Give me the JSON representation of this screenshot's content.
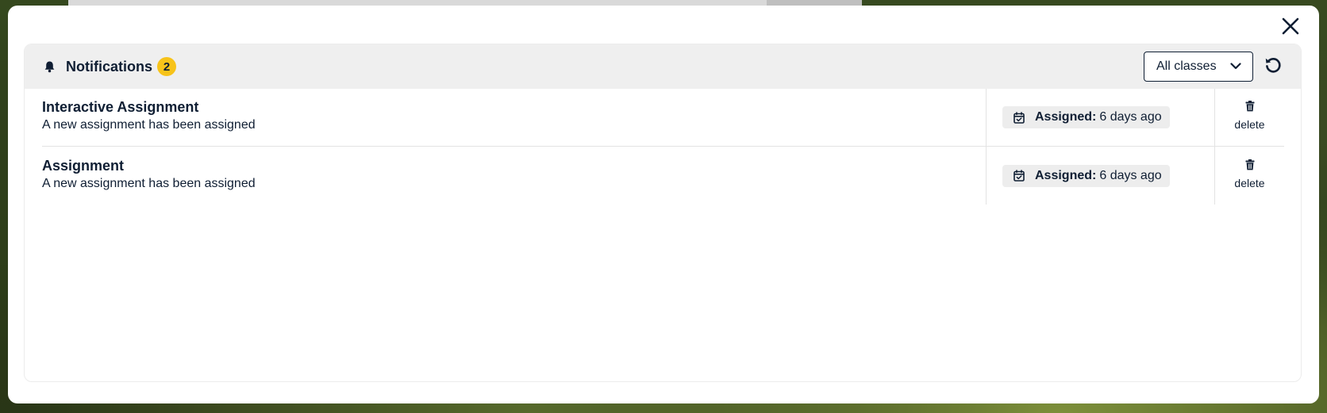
{
  "header": {
    "title": "Notifications",
    "count": "2"
  },
  "filter": {
    "selected": "All classes"
  },
  "notifications": [
    {
      "title": "Interactive Assignment",
      "description": "A new assignment has been assigned",
      "assigned_label": "Assigned:",
      "assigned_value": "6 days ago",
      "delete_label": "delete"
    },
    {
      "title": "Assignment",
      "description": "A new assignment has been assigned",
      "assigned_label": "Assigned:",
      "assigned_value": "6 days ago",
      "delete_label": "delete"
    }
  ],
  "colors": {
    "text": "#0f1e33",
    "badge": "#f7c31a",
    "header_bg": "#efefef",
    "pill_bg": "#ededed"
  },
  "icons": [
    "bell-icon",
    "chevron-down-icon",
    "refresh-icon",
    "close-icon",
    "calendar-check-icon",
    "trash-icon"
  ]
}
